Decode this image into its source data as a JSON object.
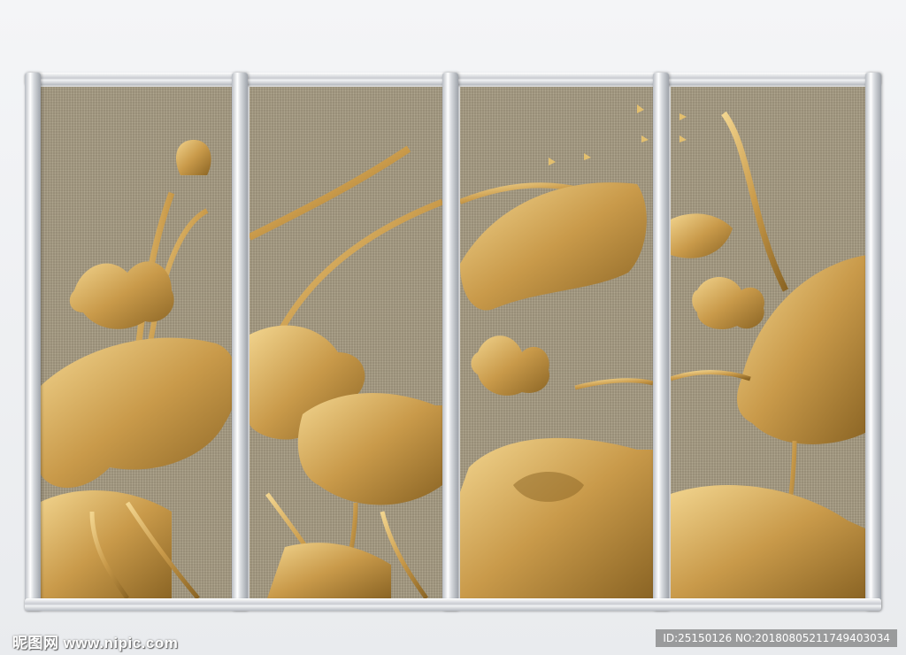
{
  "artwork": {
    "panels": 4,
    "background_color": "#a79c83",
    "gold_light": "#f2d58f",
    "gold_mid": "#c99a4a",
    "gold_dark": "#8a6424",
    "frame_color": "#d9dce0"
  },
  "watermarks": {
    "site": "昵图网 www.nipic.com",
    "image_id": "ID:25150126 NO:20180805211749403034"
  }
}
